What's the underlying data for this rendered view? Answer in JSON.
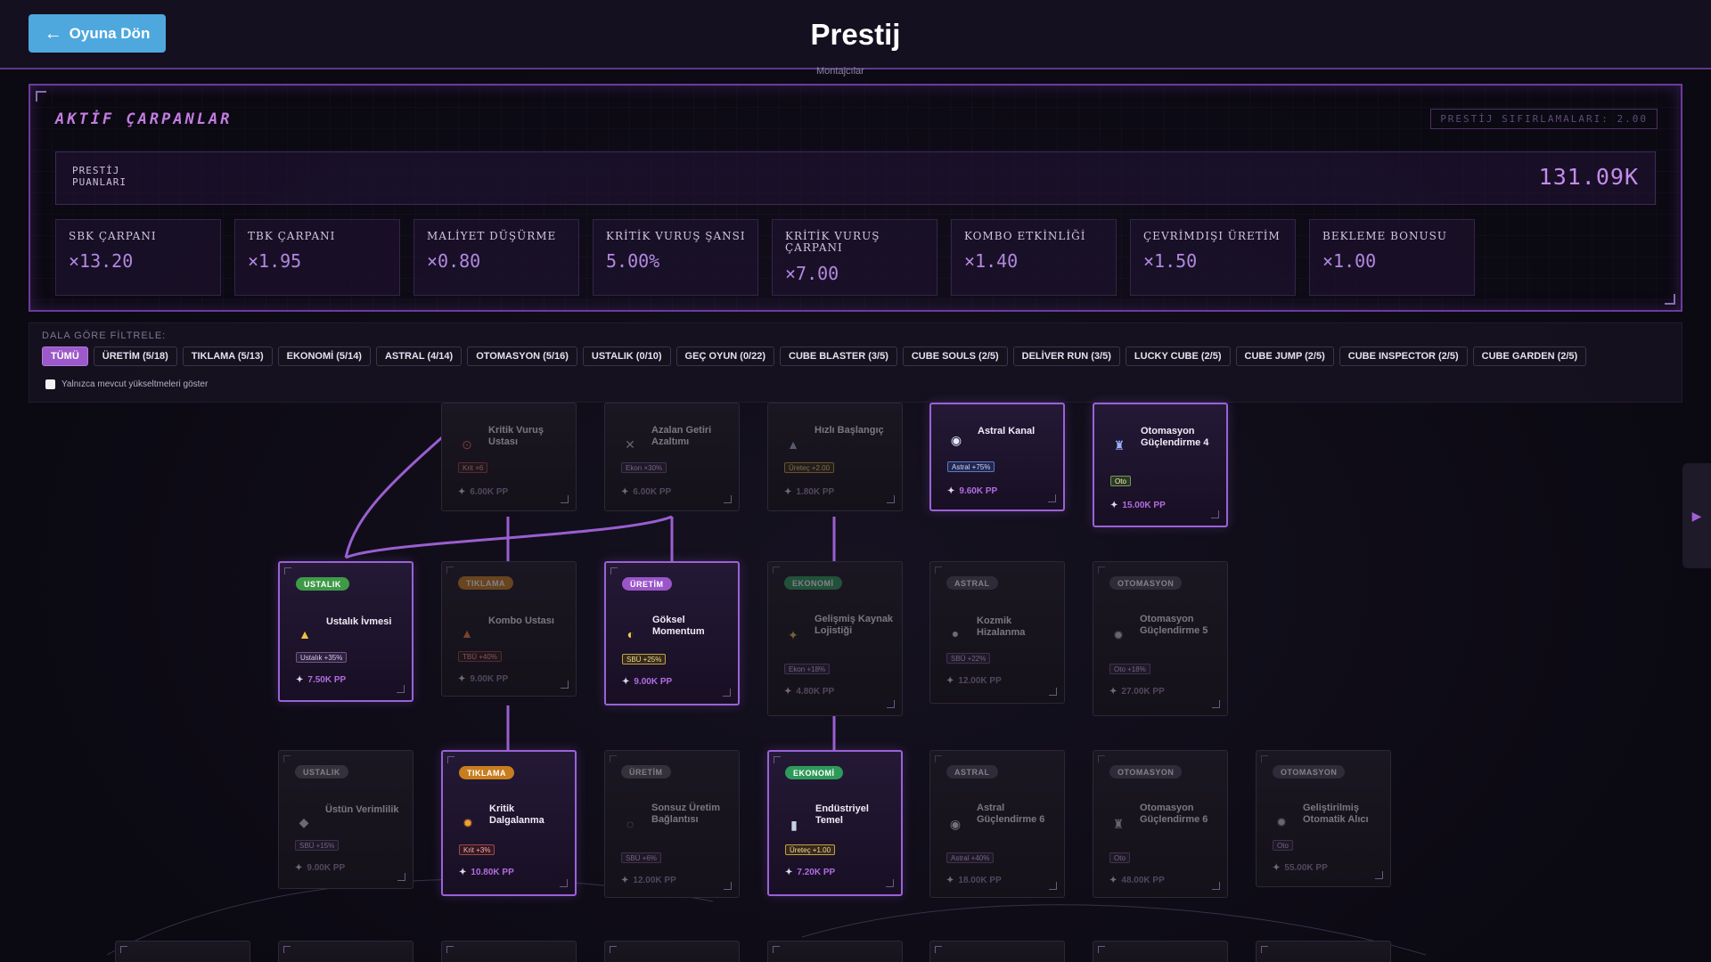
{
  "header": {
    "back_label": "Oyuna Dön",
    "title": "Prestij",
    "ghost_tab": "Montajcılar"
  },
  "multipliers": {
    "title": "AKTİF ÇARPANLAR",
    "reset_count": "PRESTİJ SIFIRLAMALARI: 2.00",
    "pp_label": "PRESTİJ PUANLARI",
    "pp_value": "131.09K",
    "stats": [
      {
        "label": "SBK ÇARPANI",
        "value": "×13.20"
      },
      {
        "label": "TBK ÇARPANI",
        "value": "×1.95"
      },
      {
        "label": "MALİYET DÜŞÜRME",
        "value": "×0.80"
      },
      {
        "label": "KRİTİK VURUŞ ŞANSI",
        "value": "5.00%"
      },
      {
        "label": "KRİTİK VURUŞ ÇARPANI",
        "value": "×7.00"
      },
      {
        "label": "KOMBO ETKİNLİĞİ",
        "value": "×1.40"
      },
      {
        "label": "ÇEVRİMDIŞI ÜRETİM",
        "value": "×1.50"
      },
      {
        "label": "BEKLEME BONUSU",
        "value": "×1.00"
      }
    ]
  },
  "filter": {
    "label": "DALA GÖRE FİLTRELE:",
    "chips": [
      "TÜMÜ",
      "ÜRETİM (5/18)",
      "TIKLAMA (5/13)",
      "EKONOMİ (5/14)",
      "ASTRAL (4/14)",
      "OTOMASYON (5/16)",
      "USTALIK (0/10)",
      "GEÇ OYUN (0/22)",
      "CUBE BLASTER (3/5)",
      "CUBE SOULS (2/5)",
      "DELİVER RUN (3/5)",
      "LUCKY CUBE (2/5)",
      "CUBE JUMP (2/5)",
      "CUBE INSPECTOR (2/5)",
      "CUBE GARDEN (2/5)"
    ],
    "only_available": "Yalnızca mevcut yükseltmeleri göster"
  },
  "colors": {
    "accent": "#9b59c9",
    "back_button": "#4ea8de",
    "link": "#9a5fd0"
  },
  "nodes": [
    {
      "name": "Kritik Vuruş Ustası",
      "badge": "",
      "icon": "⊙",
      "icon_name": "target-icon",
      "effect": "Krit ×6",
      "cost": "6.00K PP"
    },
    {
      "name": "Azalan Getiri Azaltımı",
      "badge": "",
      "icon": "✕",
      "icon_name": "cross-swords-icon",
      "effect": "Ekon ×30%",
      "cost": "6.00K PP"
    },
    {
      "name": "Hızlı Başlangıç",
      "badge": "",
      "icon": "▲",
      "icon_name": "rocket-icon",
      "effect": "Üreteç +2.00",
      "cost": "1.80K PP"
    },
    {
      "name": "Astral Kanal",
      "badge": "",
      "icon": "◉",
      "icon_name": "orb-icon",
      "effect": "Astral +75%",
      "cost": "9.60K PP"
    },
    {
      "name": "Otomasyon Güçlendirme 4",
      "badge": "",
      "icon": "♜",
      "icon_name": "robot-icon",
      "effect": "Oto",
      "cost": "15.00K PP"
    },
    {
      "name": "Ustalık İvmesi",
      "badge": "USTALIK",
      "icon": "▲",
      "icon_name": "crown-icon",
      "effect": "Ustalık +35%",
      "cost": "7.50K PP"
    },
    {
      "name": "Kombo Ustası",
      "badge": "TIKLAMA",
      "icon": "▲",
      "icon_name": "fire-icon",
      "effect": "TBÜ +40%",
      "cost": "9.00K PP"
    },
    {
      "name": "Göksel Momentum",
      "badge": "ÜRETİM",
      "icon": "◐",
      "icon_name": "comet-icon",
      "effect": "SBÜ +25%",
      "cost": "9.00K PP"
    },
    {
      "name": "Gelişmiş Kaynak Lojistiği",
      "badge": "EKONOMİ",
      "icon": "✦",
      "icon_name": "compass-icon",
      "effect": "Ekon +18%",
      "cost": "4.80K PP"
    },
    {
      "name": "Kozmik Hizalanma",
      "badge": "ASTRAL",
      "icon": "●",
      "icon_name": "planet-icon",
      "effect": "SBÜ +22%",
      "cost": "12.00K PP"
    },
    {
      "name": "Otomasyon Güçlendirme 5",
      "badge": "OTOMASYON",
      "icon": "✹",
      "icon_name": "gear-icon",
      "effect": "Oto +18%",
      "cost": "27.00K PP"
    },
    {
      "name": "Üstün Verimlilik",
      "badge": "USTALIK",
      "icon": "◆",
      "icon_name": "diamond-icon",
      "effect": "SBÜ +15%",
      "cost": "9.00K PP"
    },
    {
      "name": "Kritik Dalgalanma",
      "badge": "TIKLAMA",
      "icon": "✹",
      "icon_name": "burst-icon",
      "effect": "Krit +3%",
      "cost": "10.80K PP"
    },
    {
      "name": "Sonsuz Üretim Bağlantısı",
      "badge": "ÜRETİM",
      "icon": "◌",
      "icon_name": "infinity-icon",
      "effect": "SBÜ +6%",
      "cost": "12.00K PP"
    },
    {
      "name": "Endüstriyel Temel",
      "badge": "EKONOMİ",
      "icon": "▮",
      "icon_name": "factory-icon",
      "effect": "Üreteç +1.00",
      "cost": "7.20K PP"
    },
    {
      "name": "Astral Güçlendirme 6",
      "badge": "ASTRAL",
      "icon": "◉",
      "icon_name": "astral-orb-icon",
      "effect": "Astral +40%",
      "cost": "18.00K PP"
    },
    {
      "name": "Otomasyon Güçlendirme 6",
      "badge": "OTOMASYON",
      "icon": "♜",
      "icon_name": "robot-icon",
      "effect": "Oto",
      "cost": "48.00K PP"
    },
    {
      "name": "Geliştirilmiş Otomatik Alıcı",
      "badge": "OTOMASYON",
      "icon": "✹",
      "icon_name": "gear-icon",
      "effect": "Oto",
      "cost": "55.00K PP"
    }
  ]
}
